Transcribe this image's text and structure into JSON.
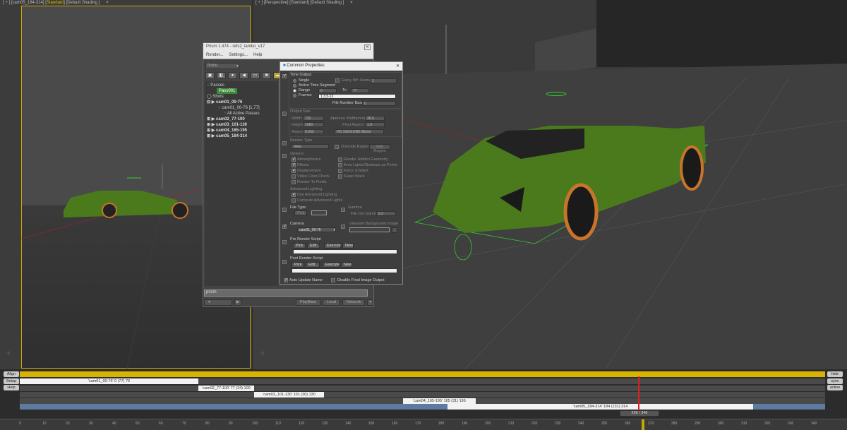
{
  "viewports": {
    "left": {
      "label_prefix": "[ + ] [",
      "camera": "cam05_184-314",
      "mid": "] [",
      "shading": "Standard",
      "sep": "] [",
      "mode": "Default Shading",
      "end": " ]"
    },
    "right": {
      "label_prefix": "[ + ] [",
      "camera": "Perspective",
      "mid": "] [",
      "shading": "Standard",
      "sep": "] [",
      "mode": "Default Shading",
      "end": " ]"
    }
  },
  "prism": {
    "title": "Prism 1.474 - refs2_lambo_v17",
    "close": "✕",
    "menu": [
      "Render...",
      "Settings...",
      "Help"
    ],
    "dropdown": "None",
    "toolbar_icons": [
      "camera-icon",
      "render-icon",
      "sphere-icon",
      "light-icon",
      "shot-icon",
      "pass-icon",
      "folder-icon"
    ],
    "tree": {
      "passes": "Passes",
      "pass001": "Pass001",
      "shots": "Shots",
      "cam01": "cam01_00-76",
      "cam01_sub": "cam01_00-76 [1,77]",
      "all_passes": "All Active Passes",
      "cam02": "cam02_77-100",
      "cam03": "cam03_101-130",
      "cam04": "cam04_165-195",
      "cam05": "cam05_184-314"
    },
    "cmdline": "prism",
    "bottom": {
      "dropdown": "",
      "preview": "PlayBlast",
      "local": "Local",
      "network": "Network"
    }
  },
  "common_properties": {
    "title": "Common Properties",
    "close": "✕",
    "time_output": {
      "header": "Time Output",
      "single": "Single",
      "every_nth": "Every Nth Frame",
      "every_nth_val": "1",
      "active_segment": "Active Time Segment",
      "range": "Range",
      "range_from": "0",
      "range_to_label": "To",
      "range_to": "77",
      "frames": "Frames",
      "frames_val": "1,3,5-12",
      "file_number_base": "File Number Base:",
      "file_number_base_val": "0"
    },
    "output_size": {
      "header": "Output Size",
      "width": "Width:",
      "width_val": "720",
      "height": "Height:",
      "height_val": "1080",
      "aperture": "Aperture Width(mm):",
      "aperture_val": "36.0",
      "pixel_aspect": "Pixel Aspect:",
      "pixel_aspect_val": "1.0",
      "aspect": "Aspect:",
      "aspect_val": "0.563",
      "preset": "HD 1920x1080 35mm"
    },
    "render_type": {
      "header": "Render Type",
      "value": "View",
      "override": "Override Region",
      "edit_region": "Edit Region"
    },
    "options": {
      "header": "Options",
      "atmospherics": "Atmospherics",
      "effects": "Effects",
      "displacement": "Displacement",
      "video_color": "Video Color Check",
      "render_fields": "Render To Fields",
      "hidden_geometry": "Render Hidden Geometry",
      "area_lights": "Area Lights/Shadows as Points",
      "force2sided": "Force 2-Sided",
      "super_black": "Super Black"
    },
    "advanced_lighting": {
      "header": "Advanced Lighting",
      "use": "Use Advanced Lighting",
      "compute": "Compute Advanced Lights"
    },
    "file_type": {
      "header": "File Type",
      "pick": "Pick",
      "gamma": "Gamma",
      "file_out_gamma": "File Out Gamma",
      "gamma_val": "2.2"
    },
    "camera": {
      "header": "Camera",
      "value": "cam01_00-76",
      "viewport_bg": "Viewport Background Image"
    },
    "pre_render": {
      "header": "Pre Render Script",
      "pick": "Pick",
      "edit": "Edit...",
      "execute": "Execute",
      "new": "New"
    },
    "post_render": {
      "header": "Post Render Script",
      "pick": "Pick",
      "edit": "Edit...",
      "execute": "Execute",
      "new": "New"
    },
    "auto_update": "Auto Update Name",
    "disable_final": "Disable Final Image Output"
  },
  "timeline": {
    "left_buttons": [
      "Align",
      "Setup",
      "Help"
    ],
    "right_buttons": [
      "hide",
      "sync",
      "active"
    ],
    "segments": [
      {
        "label": "'cam01_00-76' 0 (77) 76",
        "start": 0,
        "end": 76
      },
      {
        "label": "'cam02_77-100' 77 (24) 100",
        "start": 77,
        "end": 100
      },
      {
        "label": "'cam03_101-130' 101 (30) 130",
        "start": 101,
        "end": 130
      },
      {
        "label": "'cam04_165-195' 165 (31) 195",
        "start": 165,
        "end": 195
      },
      {
        "label": "'cam05_184-314' 184 (131) 314",
        "start": 184,
        "end": 314
      }
    ],
    "frame_indicator": "266 / 346",
    "current_frame": 266,
    "ruler_ticks": [
      0,
      10,
      20,
      30,
      40,
      50,
      60,
      70,
      80,
      90,
      100,
      110,
      120,
      130,
      140,
      150,
      160,
      170,
      180,
      190,
      200,
      210,
      220,
      230,
      240,
      250,
      260,
      270,
      280,
      290,
      300,
      310,
      320,
      330,
      340
    ]
  },
  "colors": {
    "accent_yellow": "#e0c000",
    "pass_green": "#3b8a3b",
    "car_green": "#4b7a1c",
    "wheel_orange": "#c8742a"
  }
}
